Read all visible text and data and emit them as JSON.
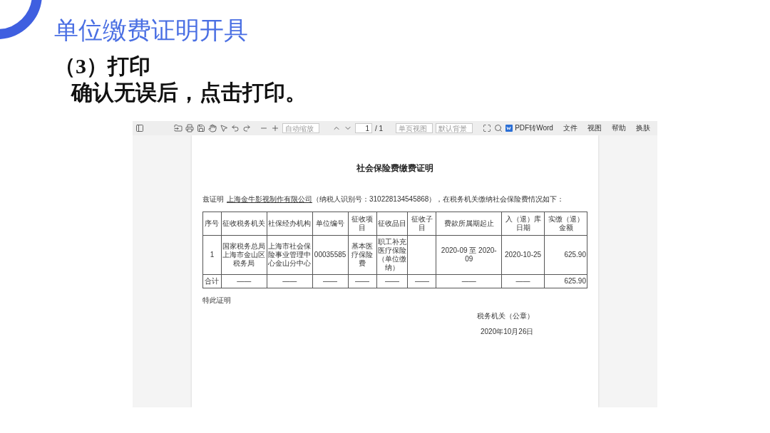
{
  "slide": {
    "title": "单位缴费证明开具",
    "step": "（3）打印",
    "instruction": "确认无误后，点击打印。"
  },
  "viewer": {
    "toolbar": {
      "zoom_field": {
        "placeholder": "自动缩放"
      },
      "page_field": {
        "value": "1"
      },
      "page_total": "/ 1",
      "view_field": {
        "placeholder": "单页视图"
      },
      "background_field": {
        "placeholder": "默认背景"
      },
      "convert_button": "PDF转Word",
      "menu": [
        "文件",
        "视图",
        "帮助",
        "换肤"
      ]
    },
    "document": {
      "title": "社会保险费缴费证明",
      "intro_prefix": "兹证明",
      "company": "上海金牛影视制作有限公司",
      "intro_suffix": "（纳税人识别号：310228134545868），在税务机关缴纳社会保险费情况如下：",
      "table": {
        "columns": [
          "序号",
          "征收税务机关",
          "社保经办机构",
          "单位编号",
          "征收项目",
          "征收品目",
          "征收子目",
          "费款所属期起止",
          "入（退）库日期",
          "实缴（退）金额"
        ],
        "rows": [
          [
            "1",
            "国家税务总局上海市金山区税务局",
            "上海市社会保险事业管理中心金山分中心",
            "00035585",
            "基本医疗保险费",
            "职工补充医疗保险（单位缴纳）",
            "",
            "2020-09 至 2020-09",
            "2020-10-25",
            "625.90"
          ],
          [
            "合计",
            "——",
            "——",
            "——",
            "——",
            "——",
            "——",
            "——",
            "——",
            "625.90"
          ]
        ]
      },
      "closing": "特此证明",
      "signature": "税务机关（公章）",
      "date": "2020年10月26日"
    }
  }
}
